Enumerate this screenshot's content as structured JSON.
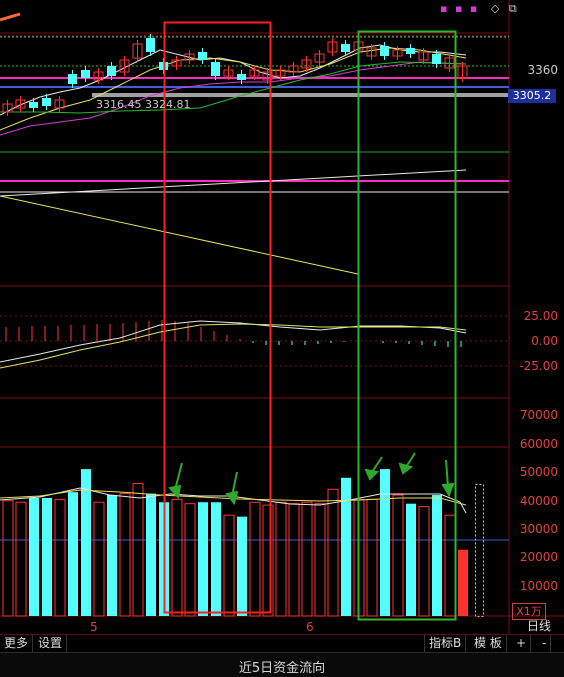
{
  "price_panel": {
    "labels": [
      "3360"
    ],
    "tag_current": "3360",
    "tag_blue": "3305.2",
    "ma_text": "3316.45  3324.81"
  },
  "macd_panel": {
    "labels": [
      "25.00",
      "0.00",
      "-25.00"
    ]
  },
  "volume_panel": {
    "labels": [
      "70000",
      "60000",
      "50000",
      "40000",
      "30000",
      "20000",
      "10000"
    ],
    "unit": "X1万"
  },
  "x_axis": {
    "labels": [
      "5",
      "6"
    ]
  },
  "toolbar": {
    "more": "更多",
    "settings": "设置",
    "indicator": "指标B",
    "template": "模 板",
    "plus": "+",
    "minus": "-",
    "daily": "日线"
  },
  "status": {
    "title": "近5日资金流向"
  },
  "top_icons": {
    "diamond": "◇",
    "restore": "⧉"
  },
  "colors": {
    "up": "#ff3232",
    "down": "#54ffff",
    "highlight_red": "#ff2020",
    "highlight_green": "#2cb82c",
    "arrow": "#2ea82e"
  },
  "chart_data": {
    "type": "bar",
    "title": "",
    "ylabel": "X1万",
    "ylim": [
      0,
      75000
    ],
    "values": [
      40000,
      39500,
      41000,
      41000,
      40500,
      43000,
      51000,
      39500,
      42000,
      42500,
      46000,
      42500,
      39500,
      40500,
      39000,
      39500,
      39500,
      35000,
      34500,
      39500,
      38500,
      39500,
      39000,
      39500,
      39000,
      44000,
      48000,
      40500,
      40500,
      51000,
      42000,
      39000,
      38000,
      42000,
      35000,
      23000
    ],
    "directions": [
      "up",
      "up",
      "down",
      "down",
      "up",
      "down",
      "down",
      "up",
      "down",
      "up",
      "up",
      "down",
      "down",
      "up",
      "up",
      "down",
      "down",
      "up",
      "down",
      "up",
      "up",
      "up",
      "up",
      "up",
      "up",
      "up",
      "down",
      "up",
      "up",
      "down",
      "up",
      "down",
      "up",
      "down",
      "up",
      "up"
    ],
    "annotations": [
      "highlight-red",
      "highlight-green",
      "arrows"
    ]
  }
}
